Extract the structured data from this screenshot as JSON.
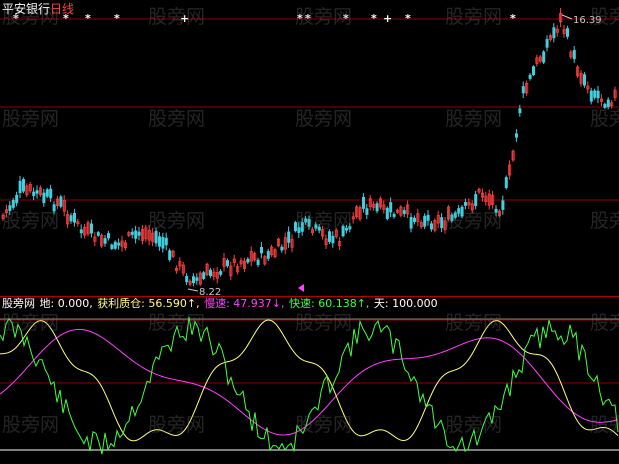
{
  "title": {
    "stock": "平安银行",
    "period": "日线"
  },
  "price_chart": {
    "high_label": "16.39",
    "low_label": "8.22",
    "markers": [
      "*",
      "*",
      "*",
      "*",
      "+",
      "*",
      "*",
      "*",
      "*",
      "+",
      "*",
      "*"
    ]
  },
  "indicator": {
    "name": "股旁网",
    "items": [
      {
        "label": "地: ",
        "value": "0.000",
        "arrow": "",
        "color": "#ffffff"
      },
      {
        "label": "获利质仓: ",
        "value": "56.590",
        "arrow": "↑",
        "color": "#ffff80"
      },
      {
        "label": "慢速: ",
        "value": "47.937",
        "arrow": "↓",
        "color": "#ff40ff"
      },
      {
        "label": "快速: ",
        "value": "60.138",
        "arrow": "↑",
        "color": "#40ff40"
      },
      {
        "label": "天: ",
        "value": "100.000",
        "arrow": "",
        "color": "#ffffff"
      }
    ]
  },
  "watermark": "股旁网",
  "colors": {
    "up": "#ff4040",
    "down": "#40d0e0",
    "grid": "#8b0000",
    "profit": "#ffff80",
    "slow": "#ff40ff",
    "fast": "#40ff40"
  }
}
